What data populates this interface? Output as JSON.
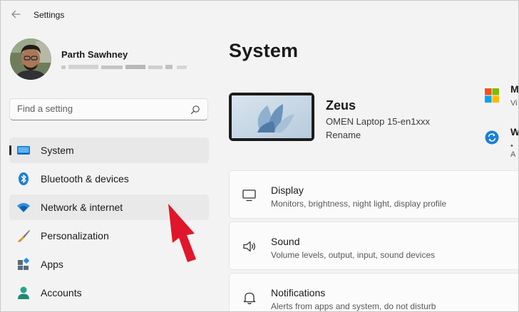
{
  "window": {
    "title": "Settings"
  },
  "profile": {
    "name": "Parth Sawhney"
  },
  "search": {
    "placeholder": "Find a setting"
  },
  "sidebar": {
    "items": [
      {
        "label": "System",
        "icon": "system-display-icon",
        "active": true
      },
      {
        "label": "Bluetooth & devices",
        "icon": "bluetooth-icon"
      },
      {
        "label": "Network & internet",
        "icon": "wifi-icon",
        "hovered": true
      },
      {
        "label": "Personalization",
        "icon": "paintbrush-icon"
      },
      {
        "label": "Apps",
        "icon": "apps-icon"
      },
      {
        "label": "Accounts",
        "icon": "person-icon"
      }
    ]
  },
  "main": {
    "title": "System",
    "device": {
      "name": "Zeus",
      "model": "OMEN Laptop 15-en1xxx",
      "rename": "Rename"
    },
    "right_truncated": [
      {
        "label": "M",
        "sub": "Vi",
        "icon": "microsoft-365-icon"
      },
      {
        "label": "W",
        "sub": "• A",
        "icon": "windows-update-icon"
      }
    ],
    "cards": [
      {
        "title": "Display",
        "desc": "Monitors, brightness, night light, display profile",
        "icon": "monitor-icon"
      },
      {
        "title": "Sound",
        "desc": "Volume levels, output, input, sound devices",
        "icon": "speaker-icon"
      },
      {
        "title": "Notifications",
        "desc": "Alerts from apps and system, do not disturb",
        "icon": "bell-icon"
      }
    ]
  },
  "colors": {
    "accent": "#0067c0",
    "arrow": "#e0162b",
    "sidebar_active": "#e8e8e8"
  }
}
